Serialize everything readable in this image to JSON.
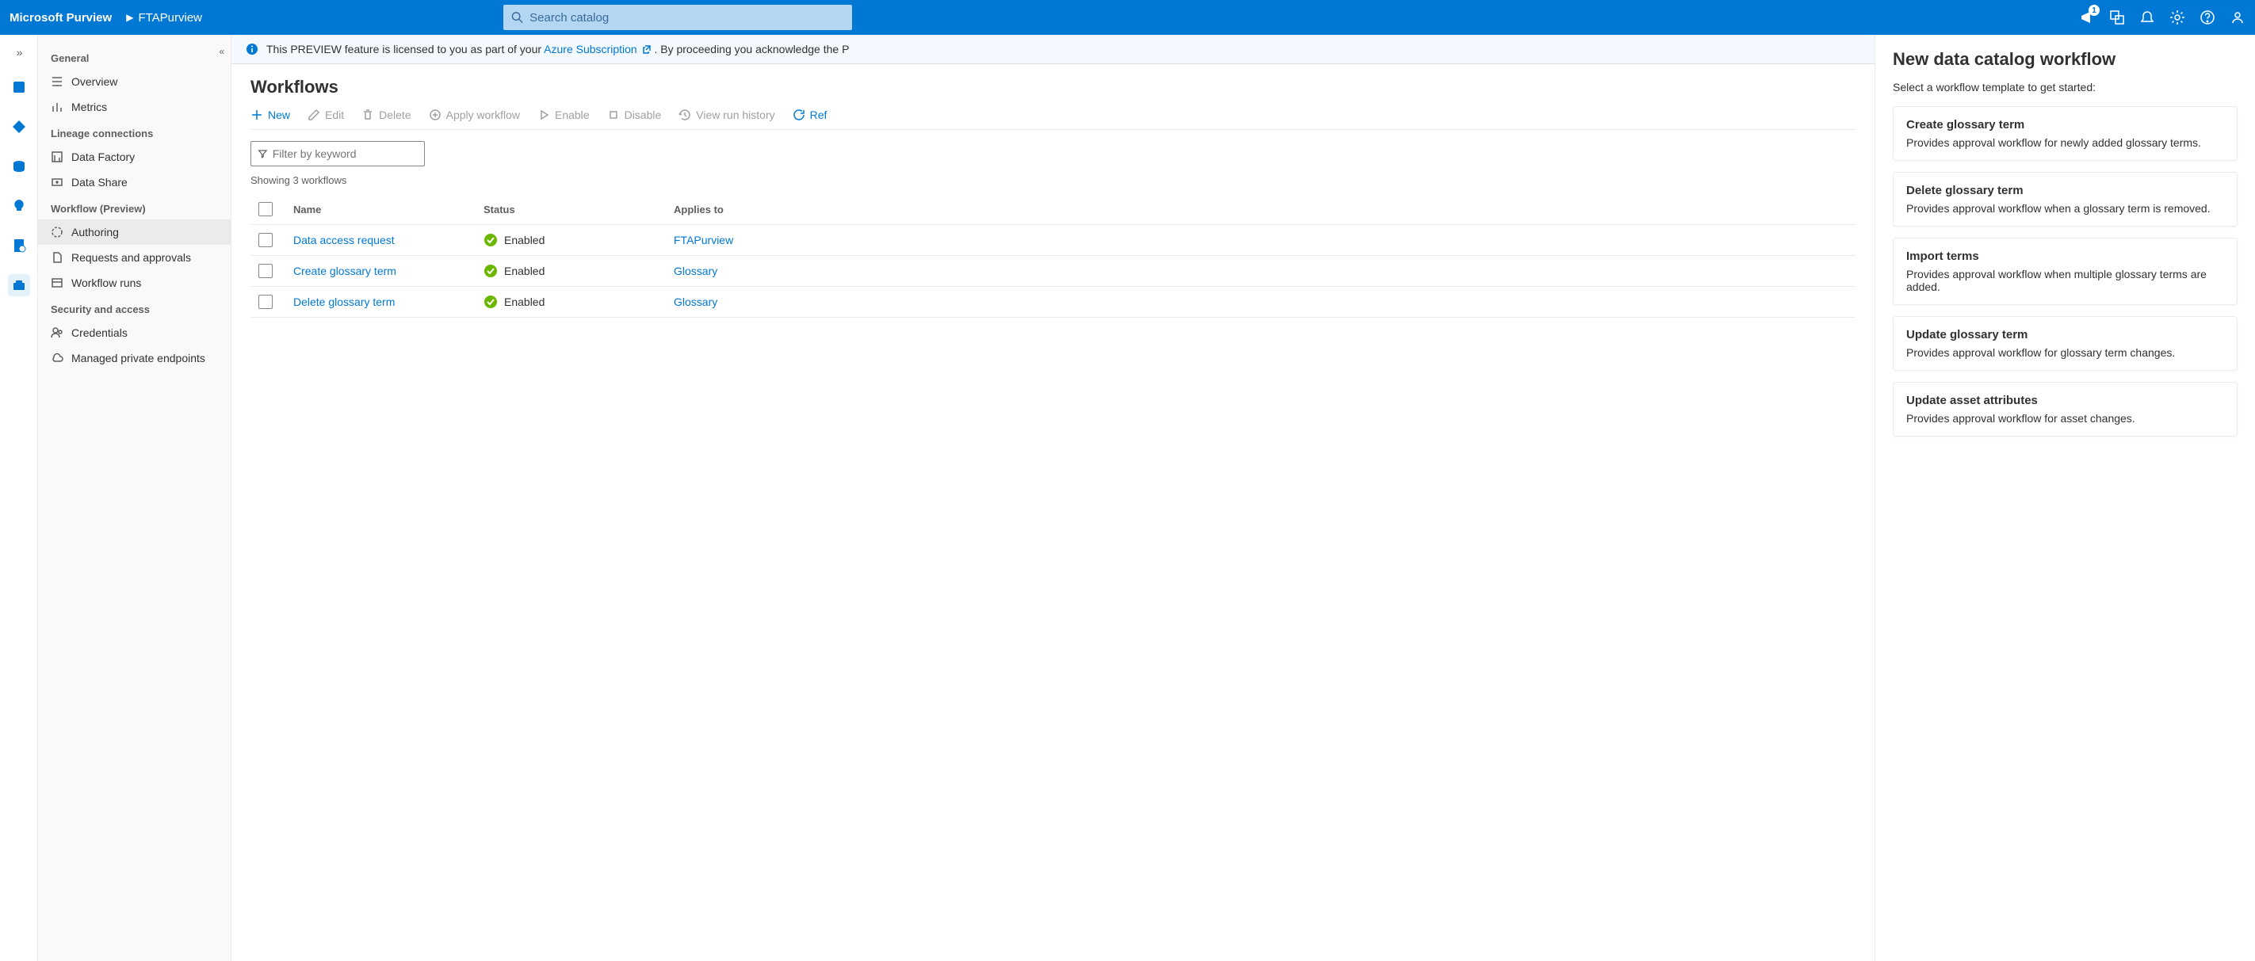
{
  "topbar": {
    "brand": "Microsoft Purview",
    "crumb": "FTAPurview",
    "search_placeholder": "Search catalog",
    "notif_count": "1"
  },
  "sidebar": {
    "sections": [
      {
        "title": "General",
        "items": [
          "Overview",
          "Metrics"
        ]
      },
      {
        "title": "Lineage connections",
        "items": [
          "Data Factory",
          "Data Share"
        ]
      },
      {
        "title": "Workflow (Preview)",
        "items": [
          "Authoring",
          "Requests and approvals",
          "Workflow runs"
        ],
        "active": "Authoring"
      },
      {
        "title": "Security and access",
        "items": [
          "Credentials",
          "Managed private endpoints"
        ]
      }
    ]
  },
  "banner": {
    "prefix": "This PREVIEW feature is licensed to you as part of your ",
    "link": "Azure Subscription",
    "suffix": ". By proceeding you acknowledge the P"
  },
  "page_title": "Workflows",
  "toolbar": {
    "new": "New",
    "edit": "Edit",
    "delete": "Delete",
    "apply": "Apply workflow",
    "enable": "Enable",
    "disable": "Disable",
    "history": "View run history",
    "refresh": "Ref"
  },
  "filter_placeholder": "Filter by keyword",
  "showing": "Showing 3 workflows",
  "columns": {
    "name": "Name",
    "status": "Status",
    "applies": "Applies to"
  },
  "rows": [
    {
      "name": "Data access request",
      "status": "Enabled",
      "applies": "FTAPurview"
    },
    {
      "name": "Create glossary term",
      "status": "Enabled",
      "applies": "Glossary"
    },
    {
      "name": "Delete glossary term",
      "status": "Enabled",
      "applies": "Glossary"
    }
  ],
  "panel": {
    "title": "New data catalog workflow",
    "subtitle": "Select a workflow template to get started:",
    "cards": [
      {
        "title": "Create glossary term",
        "desc": "Provides approval workflow for newly added glossary terms."
      },
      {
        "title": "Delete glossary term",
        "desc": "Provides approval workflow when a glossary term is removed."
      },
      {
        "title": "Import terms",
        "desc": "Provides approval workflow when multiple glossary terms are added."
      },
      {
        "title": "Update glossary term",
        "desc": "Provides approval workflow for glossary term changes."
      },
      {
        "title": "Update asset attributes",
        "desc": "Provides approval workflow for asset changes."
      }
    ]
  }
}
